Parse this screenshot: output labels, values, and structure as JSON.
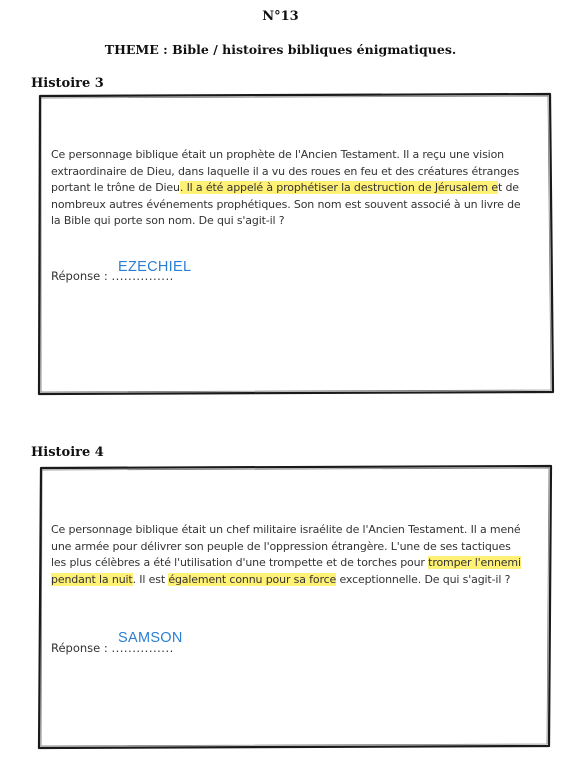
{
  "header": {
    "number": "N°13",
    "theme": "THEME : Bible / histoires bibliques énigmatiques."
  },
  "stories": [
    {
      "title": "Histoire 3",
      "text_parts": [
        "Ce personnage biblique était un prophète de l'Ancien Testament. Il a reçu une vision extraordinaire de Dieu, dans laquelle il a vu des roues en feu et des créatures étranges portant le trône de Dieu",
        ". Il a été appelé à prophétiser la destruction de Jérusalem e",
        "t de nombreux autres événements prophétiques. Son nom est souvent associé à un livre de la Bible qui porte son nom. De qui s'agit-il ?"
      ],
      "answer_label": "Réponse :",
      "answer_dots": "...............",
      "answer": "EZECHIEL"
    },
    {
      "title": "Histoire 4",
      "text_parts": [
        "Ce personnage biblique était un chef militaire israélite de l'Ancien Testament. Il a mené une armée pour délivrer son peuple de l'oppression étrangère. L'une de ses tactiques les plus célèbres a été l'utilisation d'une trompette et de torches pour ",
        "tromper l'ennemi pendant la nuit",
        ". Il est ",
        "également connu pour sa force",
        " exceptionnelle. De qui s'agit-il ?"
      ],
      "answer_label": "Réponse :",
      "answer_dots": "...............",
      "answer": "SAMSON"
    }
  ],
  "colors": {
    "highlight": "#fff176",
    "answer_ink": "#2a7fd4",
    "frame": "#1a1a1a"
  }
}
